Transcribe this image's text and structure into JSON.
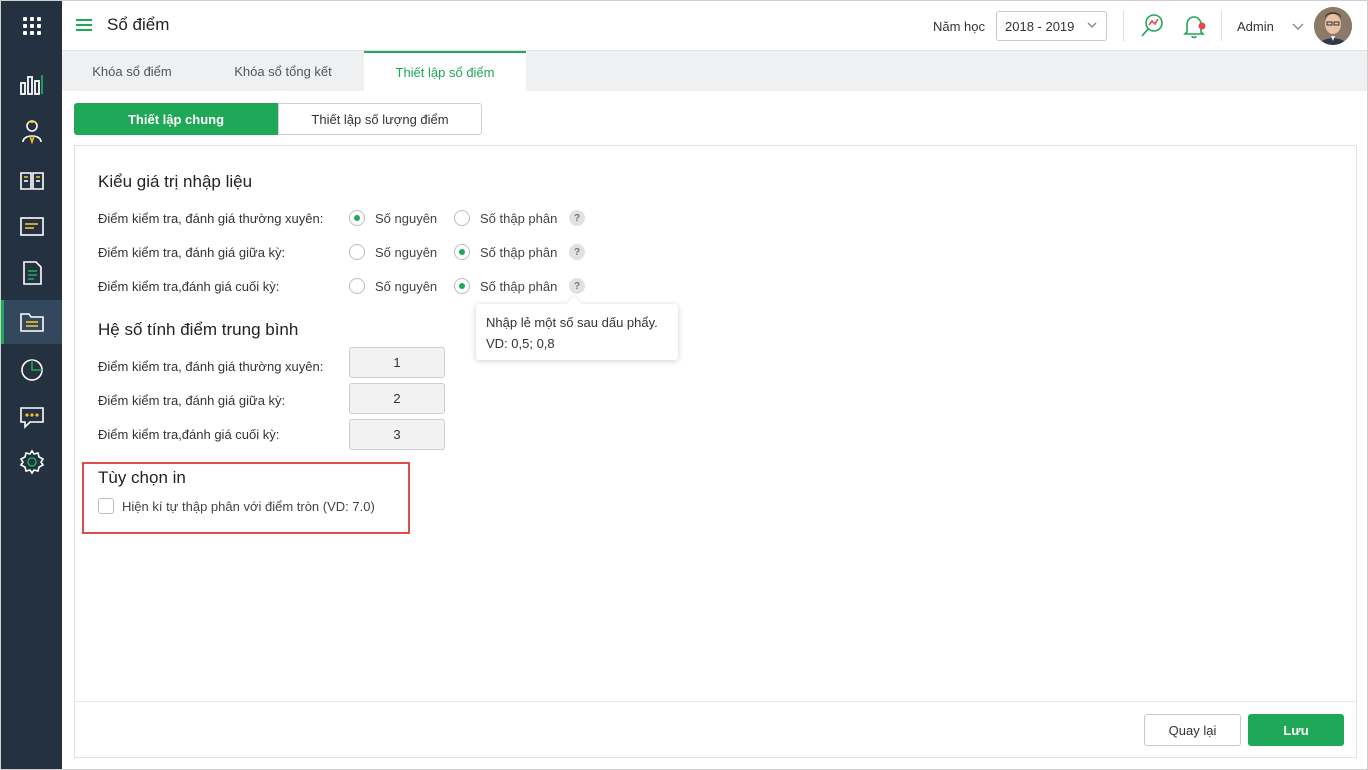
{
  "header": {
    "title": "Sổ điểm",
    "year_label": "Năm học",
    "year_value": "2018 - 2019",
    "user_name": "Admin"
  },
  "tabs": [
    {
      "label": "Khóa sổ điểm"
    },
    {
      "label": "Khóa sổ tổng kết"
    },
    {
      "label": "Thiết lập sổ điểm"
    }
  ],
  "subtabs": [
    {
      "label": "Thiết lập chung"
    },
    {
      "label": "Thiết lập số lượng điểm"
    }
  ],
  "input_type": {
    "title": "Kiểu giá trị nhập liệu",
    "option_integer": "Số nguyên",
    "option_decimal": "Số thập phân",
    "rows": [
      {
        "label": "Điểm kiểm tra, đánh giá thường xuyên:",
        "selected": "integer"
      },
      {
        "label": "Điểm kiểm tra, đánh giá giữa kỳ:",
        "selected": "decimal"
      },
      {
        "label": "Điểm kiểm tra,đánh giá cuối kỳ:",
        "selected": "decimal"
      }
    ],
    "help_mark": "?"
  },
  "tooltip": {
    "line1": "Nhập lẻ một số sau dấu phẩy.",
    "line2": "VD: 0,5; 0,8"
  },
  "coefficients": {
    "title": "Hệ số tính điểm trung bình",
    "rows": [
      {
        "label": "Điểm kiểm tra, đánh giá thường xuyên:",
        "value": "1"
      },
      {
        "label": "Điểm kiểm tra, đánh giá giữa kỳ:",
        "value": "2"
      },
      {
        "label": "Điểm kiểm tra,đánh giá cuối kỳ:",
        "value": "3"
      }
    ]
  },
  "print_options": {
    "title": "Tùy chọn in",
    "checkbox_label": "Hiện kí tự thập phân với điểm tròn (VD: 7.0)",
    "checked": false
  },
  "footer": {
    "back_label": "Quay lại",
    "save_label": "Lưu"
  },
  "colors": {
    "accent": "#1ea857",
    "sidebar": "#243140",
    "highlight": "#e04b4b"
  },
  "sidebar_icons": [
    "apps-grid-icon",
    "bar-chart-icon",
    "teacher-icon",
    "book-icon",
    "board-icon",
    "document-icon",
    "folder-list-icon",
    "pie-chart-icon",
    "chat-icon",
    "settings-icon"
  ]
}
